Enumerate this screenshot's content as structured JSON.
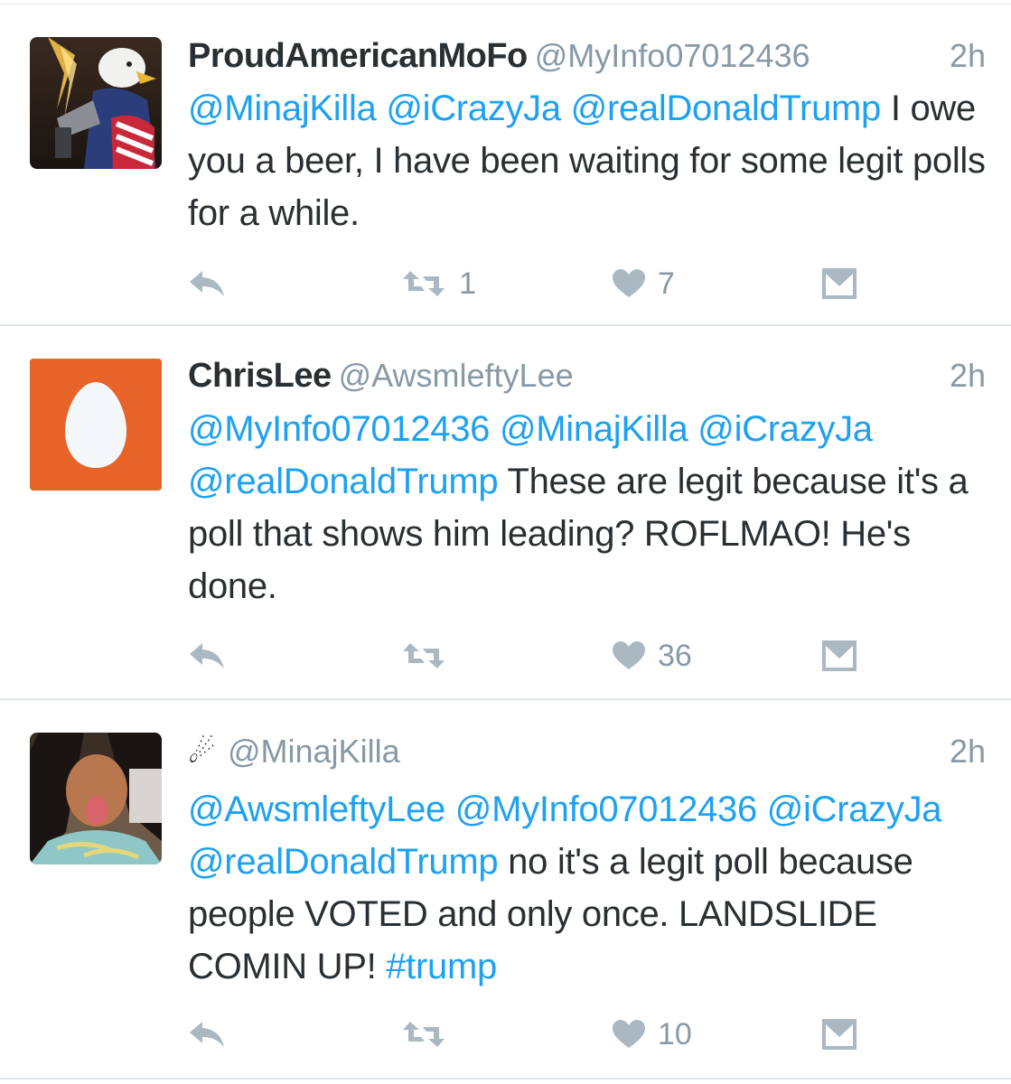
{
  "colors": {
    "link": "#1da1f2",
    "text": "#292f33",
    "muted": "#8899a6",
    "icon": "#aab8c2",
    "egg_bg": "#e8632a"
  },
  "tweets": [
    {
      "name": "ProudAmericanMoFo",
      "handle": "@MyInfo07012436",
      "time": "2h",
      "avatar_icon": "eagle-avatar-image",
      "text_parts": [
        {
          "t": "@MinajKilla",
          "link": true
        },
        {
          "t": " ",
          "link": false
        },
        {
          "t": "@iCrazyJa",
          "link": true
        },
        {
          "t": " ",
          "link": false
        },
        {
          "t": "@realDonaldTrump",
          "link": true
        },
        {
          "t": " I owe you a beer, I have been waiting for some legit polls for a while.",
          "link": false
        }
      ],
      "retweets": "1",
      "likes": "7"
    },
    {
      "name": "ChrisLee",
      "handle": "@AwsmleftyLee",
      "time": "2h",
      "avatar_icon": "egg-avatar-icon",
      "text_parts": [
        {
          "t": "@MyInfo07012436",
          "link": true
        },
        {
          "t": " ",
          "link": false
        },
        {
          "t": "@MinajKilla",
          "link": true
        },
        {
          "t": " ",
          "link": false
        },
        {
          "t": "@iCrazyJa",
          "link": true
        },
        {
          "t": " ",
          "link": false
        },
        {
          "t": "@realDonaldTrump",
          "link": true
        },
        {
          "t": " These are legit because it's a poll that shows him leading?  ROFLMAO! He's done.",
          "link": false
        }
      ],
      "retweets": "",
      "likes": "36"
    },
    {
      "name": "☄",
      "handle": "@MinajKilla",
      "time": "2h",
      "avatar_icon": "selfie-avatar-image",
      "text_parts": [
        {
          "t": "@AwsmleftyLee",
          "link": true
        },
        {
          "t": " ",
          "link": false
        },
        {
          "t": "@MyInfo07012436",
          "link": true
        },
        {
          "t": " ",
          "link": false
        },
        {
          "t": "@iCrazyJa",
          "link": true
        },
        {
          "t": " ",
          "link": false
        },
        {
          "t": "@realDonaldTrump",
          "link": true
        },
        {
          "t": " no it's a legit poll because people VOTED and only once. LANDSLIDE COMIN UP! ",
          "link": false
        },
        {
          "t": "#trump",
          "link": true
        }
      ],
      "retweets": "",
      "likes": "10"
    }
  ]
}
